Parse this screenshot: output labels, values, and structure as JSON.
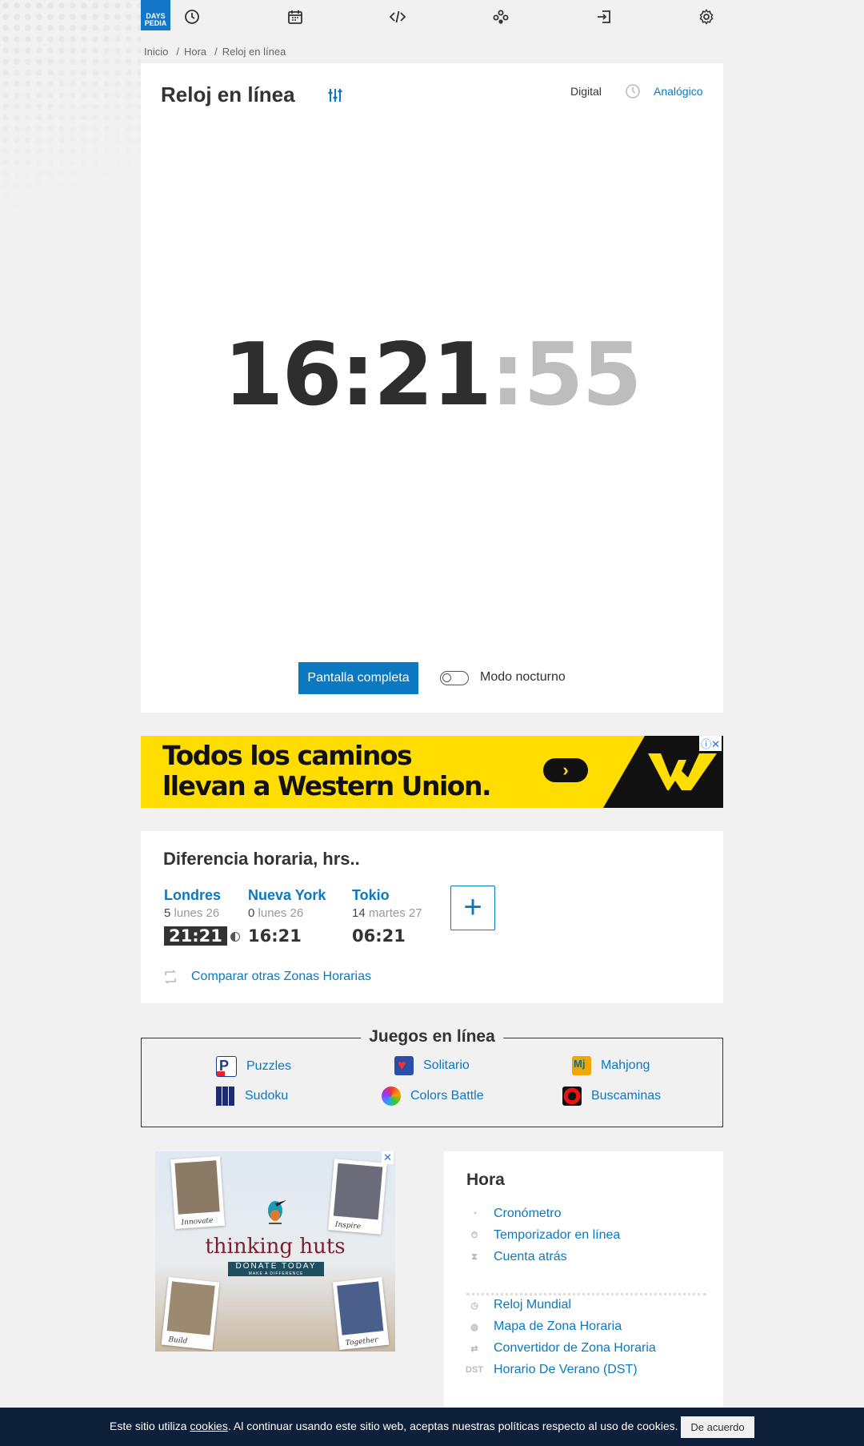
{
  "logo": {
    "line1": "DAYS",
    "line2": "PEDIA"
  },
  "nav": [
    "clock-icon",
    "calendar-icon",
    "code-icon",
    "games-icon",
    "login-icon",
    "gear-icon"
  ],
  "breadcrumb": [
    "Inicio",
    "Hora",
    "Reloj en línea"
  ],
  "clock": {
    "title": "Reloj en línea",
    "mode_digital": "Digital",
    "mode_analog": "Analógico",
    "time_hm": "16:21",
    "time_sec": ":55",
    "fullscreen": "Pantalla completa",
    "night_mode": "Modo nocturno"
  },
  "ad_banner": {
    "line1": "Todos los caminos",
    "line2": "llevan a Western Union.",
    "colors": {
      "bg": "#ffdd00",
      "dark": "#111111"
    }
  },
  "time_diff": {
    "title": "Diferencia horaria, hrs..",
    "cities": [
      {
        "name": "Londres",
        "offset": "5",
        "date": "lunes 26",
        "time": "21:21"
      },
      {
        "name": "Nueva York",
        "offset": "0",
        "date": "lunes 26",
        "time": "16:21"
      },
      {
        "name": "Tokio",
        "offset": "14",
        "date": "martes 27",
        "time": "06:21"
      }
    ],
    "add": "+",
    "compare": "Comparar otras Zonas Horarias"
  },
  "games": {
    "title": "Juegos en línea",
    "items": [
      "Puzzles",
      "Solitario",
      "Mahjong",
      "Sudoku",
      "Colors Battle",
      "Buscaminas"
    ]
  },
  "ad2": {
    "title": "thinking huts",
    "donate": "DONATE TODAY",
    "donate_sub": "MAKE A DIFFERENCE",
    "captions": [
      "Innovate",
      "Inspire",
      "Build",
      "Together"
    ]
  },
  "side": {
    "title": "Hora",
    "group1": [
      "Cronómetro",
      "Temporizador en línea",
      "Cuenta atrás"
    ],
    "group2": [
      "Reloj Mundial",
      "Mapa de Zona Horaria",
      "Convertidor de Zona Horaria",
      "Horario De Verano (DST)"
    ],
    "dst_icon_text": "DST"
  },
  "cookie": {
    "pre": "Este sitio utiliza ",
    "link": "cookies",
    "post": ". Al continuar usando este sitio web, aceptas nuestras políticas respecto al uso de cookies.",
    "button": "De acuerdo"
  },
  "colors": {
    "accent": "#0b78c2",
    "dark_bar": "#0e2039"
  }
}
